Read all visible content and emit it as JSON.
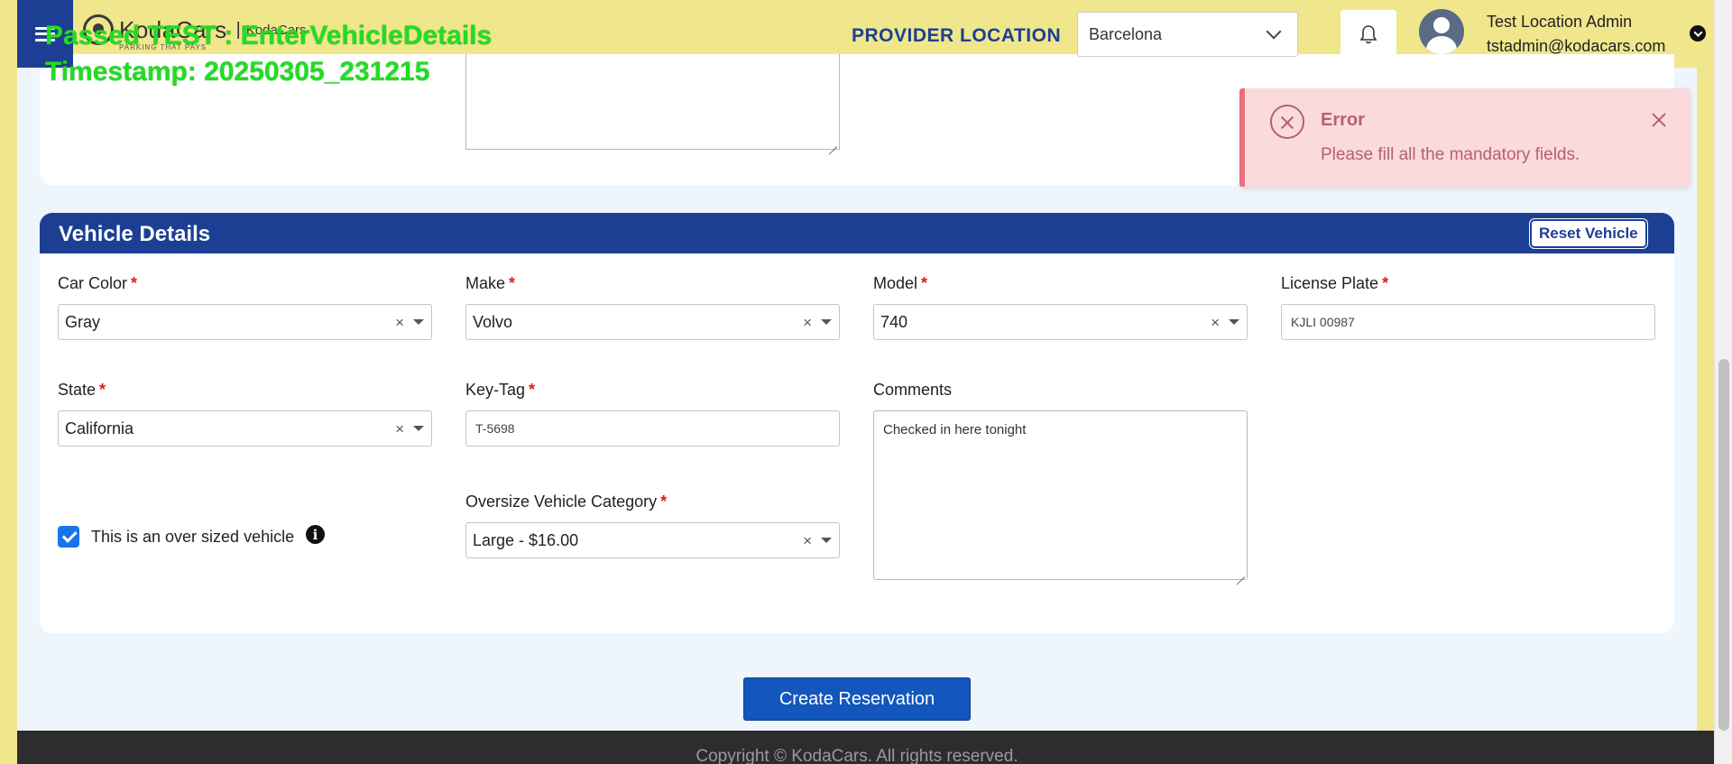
{
  "overlay": {
    "line1": "Passed TEST : EnterVehicleDetails",
    "line2": "Timestamp: 20250305_231215"
  },
  "header": {
    "brand": "KodaCars",
    "tagline": "PARKING THAT PAYS",
    "small_name": "KodaCars",
    "provider_location_label": "PROVIDER LOCATION",
    "location_value": "Barcelona",
    "user_name": "Test Location Admin",
    "user_email": "tstadmin@kodacars.com"
  },
  "toast": {
    "title": "Error",
    "message": "Please fill all the mandatory fields."
  },
  "vehicle": {
    "title": "Vehicle Details",
    "reset_label": "Reset Vehicle",
    "fields": {
      "car_color": {
        "label": "Car Color",
        "value": "Gray"
      },
      "make": {
        "label": "Make",
        "value": "Volvo"
      },
      "model": {
        "label": "Model",
        "value": "740"
      },
      "license_plate": {
        "label": "License Plate",
        "value": "KJLI 00987"
      },
      "state": {
        "label": "State",
        "value": "California"
      },
      "key_tag": {
        "label": "Key-Tag",
        "value": "T-5698"
      },
      "comments": {
        "label": "Comments",
        "value": "Checked in here tonight"
      },
      "oversize_category": {
        "label": "Oversize Vehicle Category",
        "value": "Large - $16.00"
      }
    },
    "required_marker": "*",
    "clear_glyph": "×",
    "oversize_checkbox_label": "This is an over sized vehicle",
    "oversize_checked": true
  },
  "actions": {
    "create_label": "Create Reservation"
  },
  "footer": {
    "text": "Copyright © KodaCars. All rights reserved."
  },
  "colors": {
    "header_bg": "#f0e68c",
    "brand_blue": "#1c3f94",
    "primary_button": "#1356bd",
    "error_bg": "#fadadd",
    "error_text": "#b5616b",
    "overlay_green": "#22dd22"
  }
}
